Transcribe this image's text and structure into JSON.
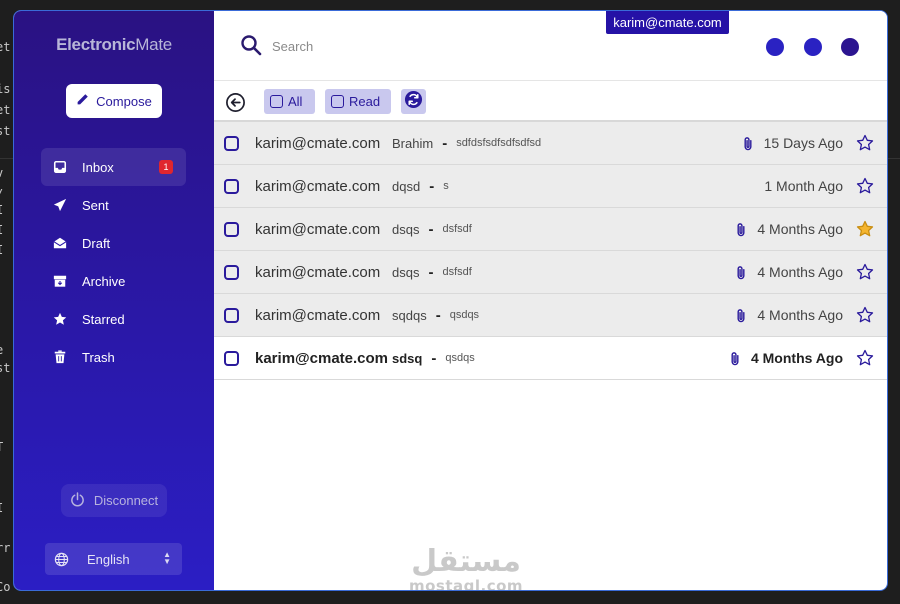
{
  "sidebar": {
    "brand_bold": "Electronic",
    "brand_light": "Mate",
    "compose_label": "Compose",
    "items": [
      {
        "label": "Inbox",
        "badge": "1"
      },
      {
        "label": "Sent"
      },
      {
        "label": "Draft"
      },
      {
        "label": "Archive"
      },
      {
        "label": "Starred"
      },
      {
        "label": "Trash"
      }
    ],
    "disconnect_label": "Disconnect",
    "language": "English"
  },
  "header": {
    "search_placeholder": "Search",
    "account": "karim@cmate.com",
    "dot_colors": [
      "#2a22c2",
      "#2a22c2",
      "#2b1490"
    ]
  },
  "toolbar": {
    "filter_all": "All",
    "filter_read": "Read"
  },
  "emails": [
    {
      "from": "karim@cmate.com",
      "subject": "Brahim",
      "snippet": "sdfdsfsdfsdfsdfsd",
      "date": "15 Days Ago",
      "attachment": true,
      "starred": false,
      "unread": false
    },
    {
      "from": "karim@cmate.com",
      "subject": "dqsd",
      "snippet": "s",
      "date": "1 Month Ago",
      "attachment": false,
      "starred": false,
      "unread": false
    },
    {
      "from": "karim@cmate.com",
      "subject": "dsqs",
      "snippet": "dsfsdf",
      "date": "4 Months Ago",
      "attachment": true,
      "starred": true,
      "unread": false
    },
    {
      "from": "karim@cmate.com",
      "subject": "dsqs",
      "snippet": "dsfsdf",
      "date": "4 Months Ago",
      "attachment": true,
      "starred": false,
      "unread": false
    },
    {
      "from": "karim@cmate.com",
      "subject": "sqdqs",
      "snippet": "qsdqs",
      "date": "4 Months Ago",
      "attachment": true,
      "starred": false,
      "unread": false
    },
    {
      "from": "karim@cmate.com",
      "subject": "sdsq",
      "snippet": "qsdqs",
      "date": "4 Months Ago",
      "attachment": true,
      "starred": false,
      "unread": true
    }
  ],
  "separator": "-",
  "watermark": {
    "arabic": "مستقل",
    "latin": "mostaql.com"
  },
  "colors": {
    "accent": "#2a1a9c",
    "star_filled": "#f5b52e",
    "badge": "#e0262e"
  },
  "background_code": {
    "lines": [
      "et",
      "is",
      "et",
      "st",
      "v",
      "/",
      "I",
      "I",
      "I",
      "e",
      "st",
      "T",
      "I",
      "rr",
      "Co"
    ]
  }
}
